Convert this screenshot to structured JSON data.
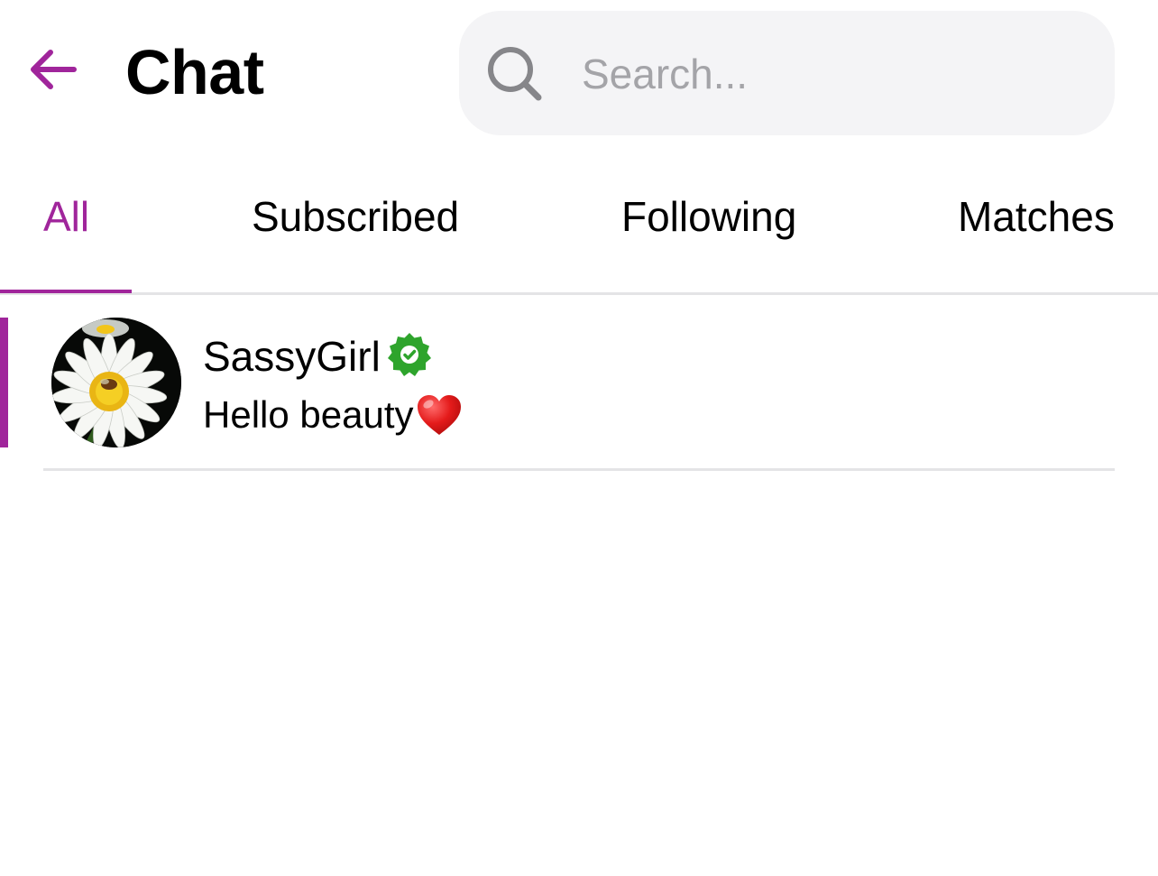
{
  "header": {
    "back_icon": "arrow-left-icon",
    "title": "Chat",
    "accent_color": "#a0259b"
  },
  "search": {
    "icon": "search-icon",
    "placeholder": "Search...",
    "value": ""
  },
  "tabs": [
    {
      "label": "All",
      "active": true
    },
    {
      "label": "Subscribed",
      "active": false
    },
    {
      "label": "Following",
      "active": false
    },
    {
      "label": "Matches",
      "active": false
    }
  ],
  "chats": [
    {
      "name": "SassyGirl",
      "verified": true,
      "verified_color": "#2ea42c",
      "verified_icon": "verified-badge-icon",
      "last_message": "Hello beauty",
      "emoji_icon": "red-heart-icon",
      "unread": true,
      "avatar": "daisy-flower-photo"
    }
  ]
}
